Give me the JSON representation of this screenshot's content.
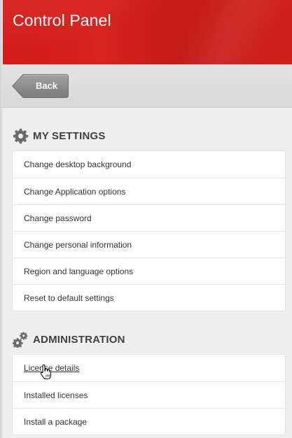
{
  "header": {
    "title": "Control Panel"
  },
  "toolbar": {
    "back_label": "Back"
  },
  "sections": [
    {
      "title": "MY SETTINGS",
      "icon": "gear-icon",
      "items": [
        {
          "label": "Change desktop background"
        },
        {
          "label": "Change Application options"
        },
        {
          "label": "Change password"
        },
        {
          "label": "Change personal information"
        },
        {
          "label": "Region and language options"
        },
        {
          "label": "Reset to default settings"
        }
      ]
    },
    {
      "title": "ADMINISTRATION",
      "icon": "gears-icon",
      "items": [
        {
          "label": "License details"
        },
        {
          "label": "Installed licenses"
        },
        {
          "label": "Install a package"
        }
      ]
    }
  ],
  "colors": {
    "header_red": "#d31a18",
    "back_button_gray": "#8a8a8a",
    "section_title": "#3f3f3f"
  }
}
